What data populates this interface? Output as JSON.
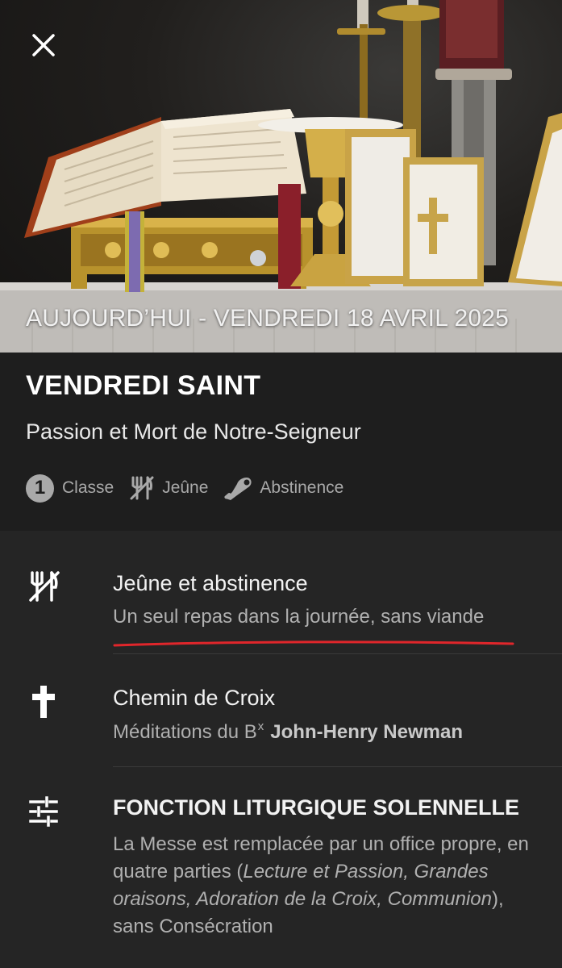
{
  "hero": {
    "date_label": "AUJOURD’HUI - VENDREDI 18 AVRIL 2025"
  },
  "feast": {
    "title": "VENDREDI SAINT",
    "subtitle": "Passion et Mort de Notre-Seigneur",
    "class_number": "1",
    "badges": {
      "class_label": "Classe",
      "fast_label": "Jeûne",
      "abstinence_label": "Abstinence"
    }
  },
  "items": [
    {
      "icon": "fasting-icon",
      "title": "Jeûne et abstinence",
      "subtitle": "Un seul repas dans la journée, sans viande",
      "annotation_color": "#e0262b"
    },
    {
      "icon": "cross-icon",
      "title": "Chemin de Croix",
      "subtitle_prefix": "Méditations du B",
      "subtitle_sup": "x",
      "subtitle_bold": "John-Henry Newman"
    },
    {
      "icon": "sliders-icon",
      "title": "FONCTION LITURGIQUE SOLENNELLE",
      "desc_1": "La Messe est remplacée par un office propre, en quatre parties (",
      "desc_italic": "Lecture et Passion, Grandes oraisons, Adoration de la Croix, Communion",
      "desc_2": "), sans Consécration"
    }
  ]
}
